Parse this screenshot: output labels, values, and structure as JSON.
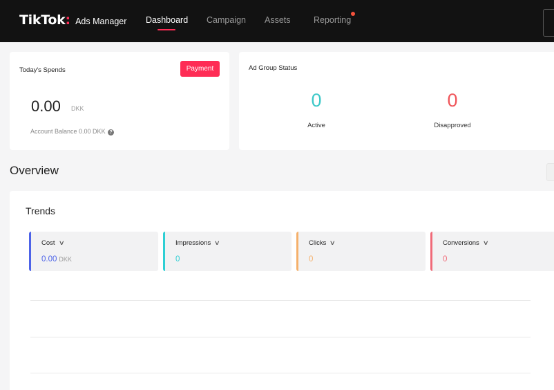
{
  "header": {
    "brand": "TikTok",
    "brand_colon": ":",
    "brand_sub": "Ads Manager",
    "nav": [
      {
        "label": "Dashboard"
      },
      {
        "label": "Campaign"
      },
      {
        "label": "Assets"
      },
      {
        "label": "Reporting"
      }
    ]
  },
  "spends": {
    "title": "Today's Spends",
    "payment_label": "Payment",
    "amount": "0.00",
    "currency": "DKK",
    "balance": "Account Balance 0.00 DKK",
    "help_glyph": "?"
  },
  "ad_group_status": {
    "title": "Ad Group Status",
    "active_value": "0",
    "active_label": "Active",
    "disapproved_value": "0",
    "disapproved_label": "Disapproved"
  },
  "overview": {
    "title": "Overview"
  },
  "trends": {
    "title": "Trends",
    "metrics": [
      {
        "label": "Cost",
        "value": "0.00",
        "currency": "DKK"
      },
      {
        "label": "Impressions",
        "value": "0"
      },
      {
        "label": "Clicks",
        "value": "0"
      },
      {
        "label": "Conversions",
        "value": "0"
      }
    ],
    "chevron": "∨"
  },
  "colors": {
    "brand": "#fe2c55",
    "active": "#3cc8c8",
    "disapproved": "#f0555a",
    "cost": "#4d63e8",
    "impressions": "#2ecfd4",
    "clicks": "#f5b06a",
    "conversions": "#f06a78"
  }
}
